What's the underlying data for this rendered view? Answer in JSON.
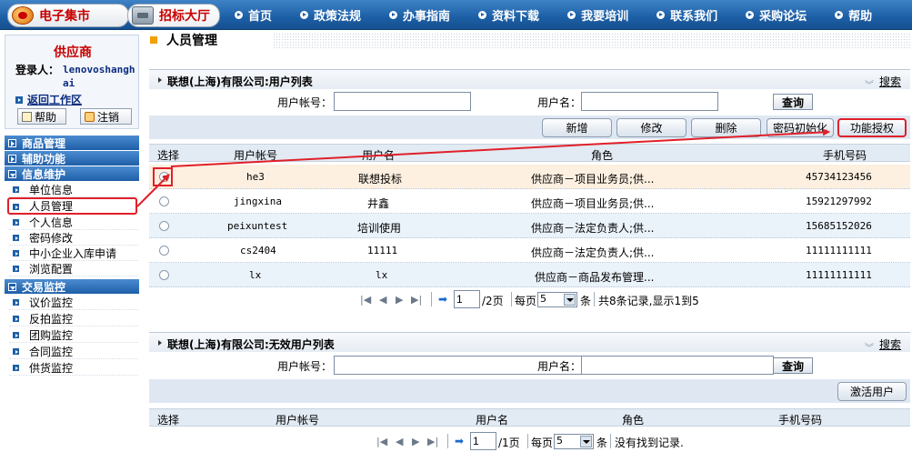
{
  "nav": {
    "brand": "电子集市",
    "bid_hall": "招标大厅",
    "items": [
      "首页",
      "政策法规",
      "办事指南",
      "资料下载",
      "我要培训",
      "联系我们",
      "采购论坛",
      "帮助"
    ]
  },
  "sidebar": {
    "supplier_title": "供应商",
    "login_label": "登录人：",
    "login_user": "lenovoshanghai",
    "back_link": "返回工作区",
    "help_btn": "帮助",
    "logout_btn": "注销",
    "groups": [
      {
        "label": "商品管理",
        "open": false
      },
      {
        "label": "辅助功能",
        "open": false
      },
      {
        "label": "信息维护",
        "open": true,
        "items": [
          "单位信息",
          "人员管理",
          "个人信息",
          "密码修改",
          "中小企业入库申请",
          "浏览配置"
        ]
      },
      {
        "label": "交易监控",
        "open": true,
        "items": [
          "议价监控",
          "反拍监控",
          "团购监控",
          "合同监控",
          "供货监控"
        ]
      }
    ]
  },
  "main": {
    "page_title": "人员管理",
    "section1": {
      "title": "联想(上海)有限公司:用户列表",
      "search_link": "搜索",
      "user_account_label": "用户帐号：",
      "user_name_label": "用户名：",
      "user_account_value": "",
      "user_name_value": "",
      "query_btn": "查询",
      "toolbar": [
        "新增",
        "修改",
        "删除",
        "密码初始化",
        "功能授权"
      ],
      "columns": [
        "选择",
        "用户帐号",
        "用户名",
        "角色",
        "手机号码"
      ],
      "rows": [
        {
          "account": "he3",
          "name": "联想投标",
          "role": "供应商－项目业务员;供...",
          "phone": "45734123456",
          "selected": true
        },
        {
          "account": "jingxina",
          "name": "井鑫",
          "role": "供应商－项目业务员;供...",
          "phone": "15921297992",
          "selected": false
        },
        {
          "account": "peixuntest",
          "name": "培训使用",
          "role": "供应商－法定负责人;供...",
          "phone": "15685152026",
          "selected": false
        },
        {
          "account": "cs2404",
          "name": "11111",
          "role": "供应商－法定负责人;供...",
          "phone": "11111111111",
          "selected": false
        },
        {
          "account": "lx",
          "name": "lx",
          "role": "供应商－商品发布管理...",
          "phone": "11111111111",
          "selected": false
        }
      ],
      "pager": {
        "page": "1",
        "total_pages": "/2页",
        "per_page_label": "每页",
        "per_page": "5",
        "unit": "条",
        "summary": "共8条记录,显示1到5"
      }
    },
    "section2": {
      "title": "联想(上海)有限公司:无效用户列表",
      "search_link": "搜索",
      "user_account_label": "用户帐号：",
      "user_name_label": "用户名：",
      "user_account_value": "",
      "user_name_value": "",
      "query_btn": "查询",
      "activate_btn": "激活用户",
      "columns": [
        "选择",
        "用户帐号",
        "用户名",
        "角色",
        "手机号码"
      ],
      "pager": {
        "page": "1",
        "total_pages": "/1页",
        "per_page_label": "每页",
        "per_page": "5",
        "unit": "条",
        "summary": "没有找到记录."
      }
    }
  },
  "colors": {
    "accent_blue": "#1c5fa6",
    "highlight_red": "#e0202a",
    "brand_red": "#c80000"
  }
}
